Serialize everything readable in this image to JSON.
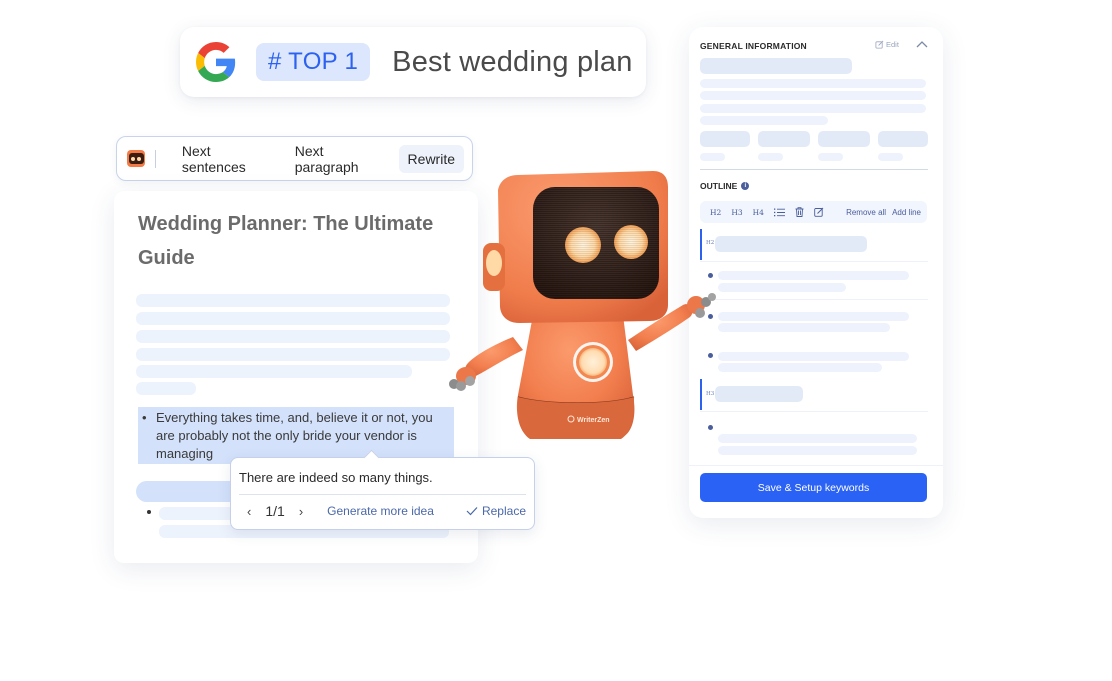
{
  "rank_card": {
    "logo": "google-g-logo",
    "badge": "# TOP 1",
    "keyword": "Best wedding plan",
    "badge_color": "#2d62f0",
    "badge_bg": "#dce7fd"
  },
  "ai_toolbar": {
    "logo": "writerzen-bot-icon",
    "buttons": [
      {
        "label": "Next sentences",
        "active": false
      },
      {
        "label": "Next paragraph",
        "active": false
      },
      {
        "label": "Rewrite",
        "active": true
      }
    ]
  },
  "editor": {
    "title": "Wedding Planner: The Ultimate Guide",
    "highlighted_bullet": "Everything takes time, and, believe it or not, you are probably not the only bride your vendor is managing",
    "bullet_char": "•"
  },
  "suggestion": {
    "text": "There are indeed so many things.",
    "prev_icon": "chevron-left-icon",
    "next_icon": "chevron-right-icon",
    "counter": "1/1",
    "generate_label": "Generate more idea",
    "replace_label": "Replace",
    "replace_icon": "check-icon"
  },
  "robot": {
    "brand_label": "WriterZen",
    "body_color": "#f27e4e"
  },
  "panel": {
    "general_title": "GENERAL INFORMATION",
    "edit_label": "Edit",
    "edit_icon": "edit-icon",
    "collapse_icon": "chevron-up-icon",
    "outline_title": "OUTLINE",
    "outline_info_icon": "info-icon",
    "outline_toolbar": {
      "h2": "H2",
      "h3": "H3",
      "h4": "H4",
      "list_icon": "list-icon",
      "delete_icon": "trash-icon",
      "edit_icon": "edit-icon",
      "remove_all": "Remove all",
      "add_line": "Add line"
    },
    "outline_rows": [
      {
        "type": "heading",
        "tag": "H2"
      },
      {
        "type": "bullet"
      },
      {
        "type": "bullet"
      },
      {
        "type": "bullet"
      },
      {
        "type": "heading",
        "tag": "H3"
      },
      {
        "type": "bullet"
      }
    ],
    "save_button": "Save & Setup keywords",
    "accent": "#2a62f5"
  }
}
